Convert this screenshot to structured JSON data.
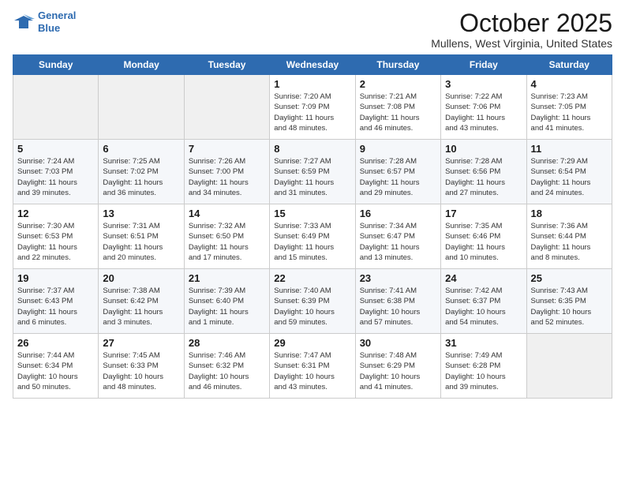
{
  "logo": {
    "line1": "General",
    "line2": "Blue"
  },
  "title": "October 2025",
  "location": "Mullens, West Virginia, United States",
  "weekdays": [
    "Sunday",
    "Monday",
    "Tuesday",
    "Wednesday",
    "Thursday",
    "Friday",
    "Saturday"
  ],
  "weeks": [
    [
      {
        "day": "",
        "info": ""
      },
      {
        "day": "",
        "info": ""
      },
      {
        "day": "",
        "info": ""
      },
      {
        "day": "1",
        "info": "Sunrise: 7:20 AM\nSunset: 7:09 PM\nDaylight: 11 hours\nand 48 minutes."
      },
      {
        "day": "2",
        "info": "Sunrise: 7:21 AM\nSunset: 7:08 PM\nDaylight: 11 hours\nand 46 minutes."
      },
      {
        "day": "3",
        "info": "Sunrise: 7:22 AM\nSunset: 7:06 PM\nDaylight: 11 hours\nand 43 minutes."
      },
      {
        "day": "4",
        "info": "Sunrise: 7:23 AM\nSunset: 7:05 PM\nDaylight: 11 hours\nand 41 minutes."
      }
    ],
    [
      {
        "day": "5",
        "info": "Sunrise: 7:24 AM\nSunset: 7:03 PM\nDaylight: 11 hours\nand 39 minutes."
      },
      {
        "day": "6",
        "info": "Sunrise: 7:25 AM\nSunset: 7:02 PM\nDaylight: 11 hours\nand 36 minutes."
      },
      {
        "day": "7",
        "info": "Sunrise: 7:26 AM\nSunset: 7:00 PM\nDaylight: 11 hours\nand 34 minutes."
      },
      {
        "day": "8",
        "info": "Sunrise: 7:27 AM\nSunset: 6:59 PM\nDaylight: 11 hours\nand 31 minutes."
      },
      {
        "day": "9",
        "info": "Sunrise: 7:28 AM\nSunset: 6:57 PM\nDaylight: 11 hours\nand 29 minutes."
      },
      {
        "day": "10",
        "info": "Sunrise: 7:28 AM\nSunset: 6:56 PM\nDaylight: 11 hours\nand 27 minutes."
      },
      {
        "day": "11",
        "info": "Sunrise: 7:29 AM\nSunset: 6:54 PM\nDaylight: 11 hours\nand 24 minutes."
      }
    ],
    [
      {
        "day": "12",
        "info": "Sunrise: 7:30 AM\nSunset: 6:53 PM\nDaylight: 11 hours\nand 22 minutes."
      },
      {
        "day": "13",
        "info": "Sunrise: 7:31 AM\nSunset: 6:51 PM\nDaylight: 11 hours\nand 20 minutes."
      },
      {
        "day": "14",
        "info": "Sunrise: 7:32 AM\nSunset: 6:50 PM\nDaylight: 11 hours\nand 17 minutes."
      },
      {
        "day": "15",
        "info": "Sunrise: 7:33 AM\nSunset: 6:49 PM\nDaylight: 11 hours\nand 15 minutes."
      },
      {
        "day": "16",
        "info": "Sunrise: 7:34 AM\nSunset: 6:47 PM\nDaylight: 11 hours\nand 13 minutes."
      },
      {
        "day": "17",
        "info": "Sunrise: 7:35 AM\nSunset: 6:46 PM\nDaylight: 11 hours\nand 10 minutes."
      },
      {
        "day": "18",
        "info": "Sunrise: 7:36 AM\nSunset: 6:44 PM\nDaylight: 11 hours\nand 8 minutes."
      }
    ],
    [
      {
        "day": "19",
        "info": "Sunrise: 7:37 AM\nSunset: 6:43 PM\nDaylight: 11 hours\nand 6 minutes."
      },
      {
        "day": "20",
        "info": "Sunrise: 7:38 AM\nSunset: 6:42 PM\nDaylight: 11 hours\nand 3 minutes."
      },
      {
        "day": "21",
        "info": "Sunrise: 7:39 AM\nSunset: 6:40 PM\nDaylight: 11 hours\nand 1 minute."
      },
      {
        "day": "22",
        "info": "Sunrise: 7:40 AM\nSunset: 6:39 PM\nDaylight: 10 hours\nand 59 minutes."
      },
      {
        "day": "23",
        "info": "Sunrise: 7:41 AM\nSunset: 6:38 PM\nDaylight: 10 hours\nand 57 minutes."
      },
      {
        "day": "24",
        "info": "Sunrise: 7:42 AM\nSunset: 6:37 PM\nDaylight: 10 hours\nand 54 minutes."
      },
      {
        "day": "25",
        "info": "Sunrise: 7:43 AM\nSunset: 6:35 PM\nDaylight: 10 hours\nand 52 minutes."
      }
    ],
    [
      {
        "day": "26",
        "info": "Sunrise: 7:44 AM\nSunset: 6:34 PM\nDaylight: 10 hours\nand 50 minutes."
      },
      {
        "day": "27",
        "info": "Sunrise: 7:45 AM\nSunset: 6:33 PM\nDaylight: 10 hours\nand 48 minutes."
      },
      {
        "day": "28",
        "info": "Sunrise: 7:46 AM\nSunset: 6:32 PM\nDaylight: 10 hours\nand 46 minutes."
      },
      {
        "day": "29",
        "info": "Sunrise: 7:47 AM\nSunset: 6:31 PM\nDaylight: 10 hours\nand 43 minutes."
      },
      {
        "day": "30",
        "info": "Sunrise: 7:48 AM\nSunset: 6:29 PM\nDaylight: 10 hours\nand 41 minutes."
      },
      {
        "day": "31",
        "info": "Sunrise: 7:49 AM\nSunset: 6:28 PM\nDaylight: 10 hours\nand 39 minutes."
      },
      {
        "day": "",
        "info": ""
      }
    ]
  ]
}
